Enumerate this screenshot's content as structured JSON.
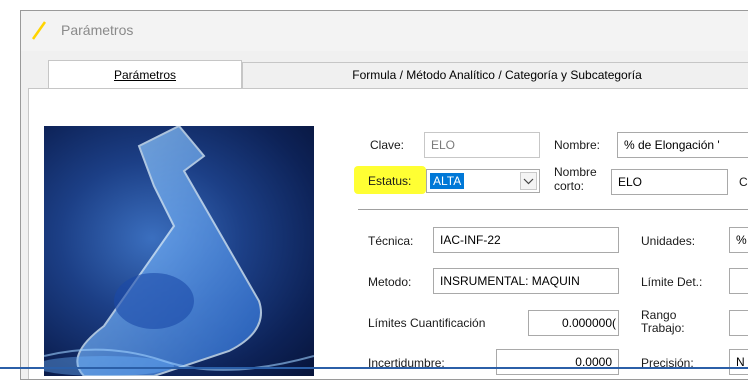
{
  "window": {
    "title": "Parámetros",
    "accent": "#ffd700"
  },
  "tabs": [
    {
      "label": "Parámetros",
      "active": true
    },
    {
      "label": "Formula / Método Analítico / Categoría y Subcategoría",
      "active": false
    }
  ],
  "form": {
    "clave_label": "Clave:",
    "clave_value": "ELO",
    "nombre_label": "Nombre:",
    "nombre_value": "% de Elongación '",
    "estatus_label": "Estatus:",
    "estatus_value": "ALTA",
    "nombre_corto_label_1": "Nombre",
    "nombre_corto_label_2": "corto:",
    "nombre_corto_value": "ELO",
    "cut_label": "C",
    "tecnica_label": "Técnica:",
    "tecnica_value": "IAC-INF-22",
    "unidades_label": "Unidades:",
    "unidades_value": "%",
    "metodo_label": "Metodo:",
    "metodo_value": "INSRUMENTAL: MAQUIN",
    "limite_det_label": "Límite Det.:",
    "limite_det_value": "",
    "limites_cuant_label": "Límites Cuantificación",
    "limites_cuant_value": "0.000000(",
    "rango_label_1": "Rango",
    "rango_label_2": "Trabajo:",
    "rango_value": "",
    "incertidumbre_label": "Incertidumbre:",
    "incertidumbre_value": "0.0000",
    "precision_label": "Precisión:",
    "precision_value": "N"
  },
  "colors": {
    "highlight": "#ffff33",
    "selection": "#0078d7"
  }
}
